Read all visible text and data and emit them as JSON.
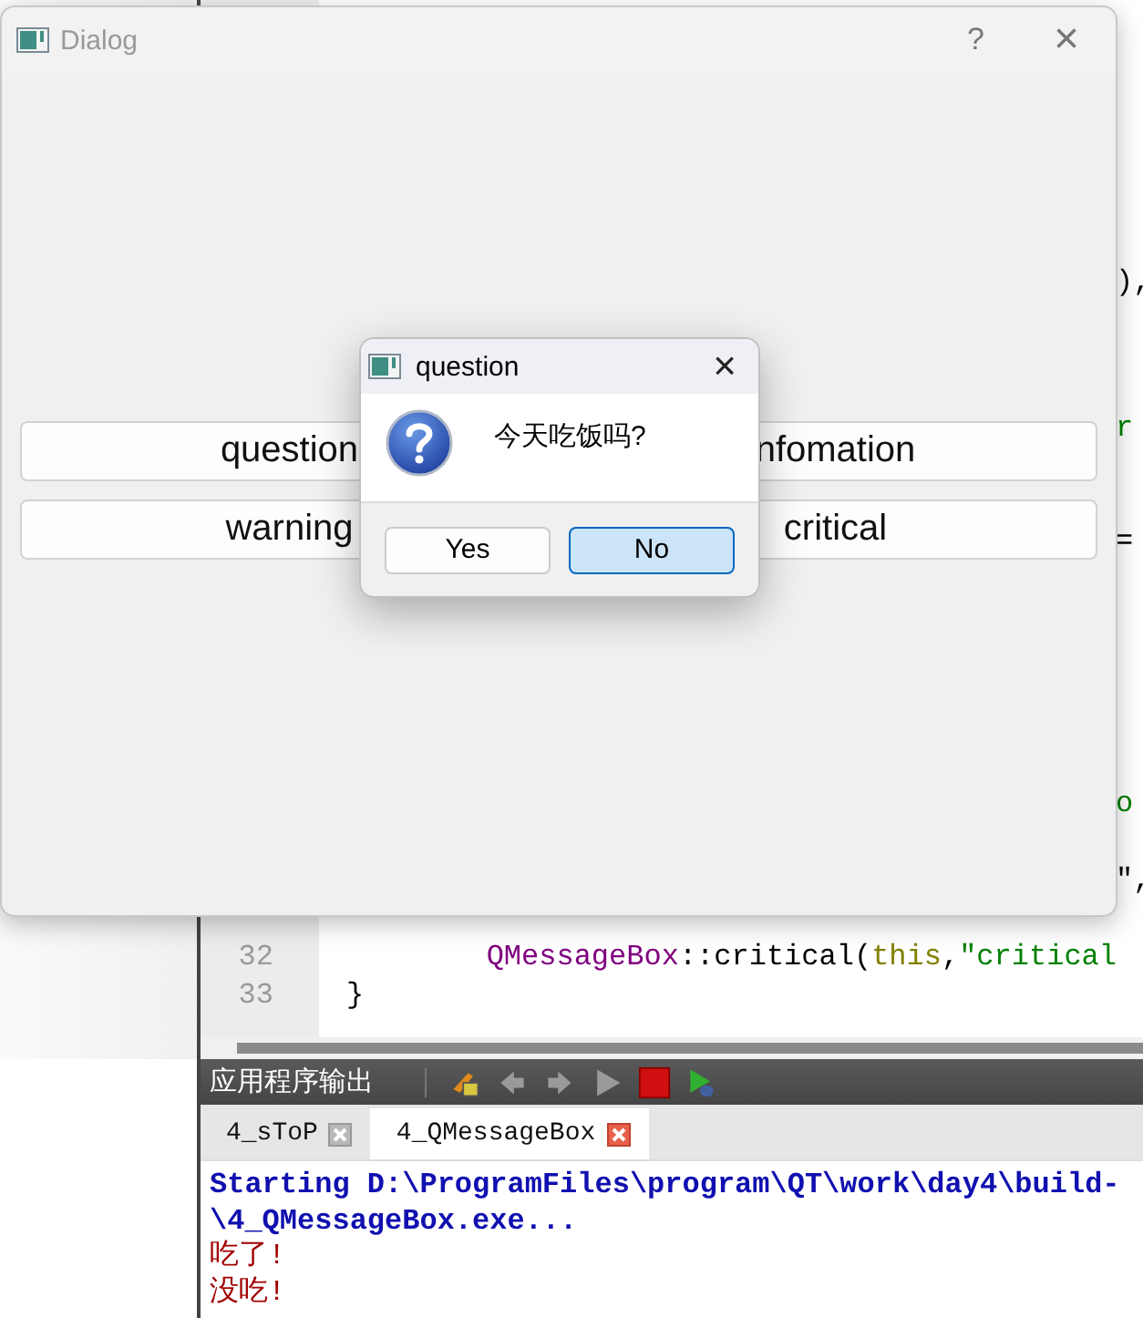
{
  "editor": {
    "right_fragments": [
      {
        "tokens": [
          {
            "kind": "plain",
            "text": "),"
          }
        ]
      },
      {
        "tokens": [
          {
            "kind": "string",
            "text": "r"
          }
        ]
      },
      {
        "tokens": [
          {
            "kind": "plain",
            "text": "="
          }
        ]
      },
      {
        "tokens": [
          {
            "kind": "string",
            "text": "o"
          }
        ]
      },
      {
        "tokens": [
          {
            "kind": "plain",
            "text": "\","
          }
        ]
      }
    ],
    "lines": [
      {
        "number": "32",
        "tokens": [
          {
            "kind": "type",
            "text": "        QMessageBox"
          },
          {
            "kind": "plain",
            "text": "::critical("
          },
          {
            "kind": "keyword",
            "text": "this"
          },
          {
            "kind": "plain",
            "text": ","
          },
          {
            "kind": "string",
            "text": "\"critical"
          }
        ]
      },
      {
        "number": "33",
        "tokens": [
          {
            "kind": "plain",
            "text": "}"
          }
        ]
      }
    ]
  },
  "output": {
    "title": "应用程序输出",
    "tools": [
      {
        "kind": "clear",
        "disabled": false
      },
      {
        "kind": "prev",
        "disabled": true
      },
      {
        "kind": "next",
        "disabled": true
      },
      {
        "kind": "run",
        "disabled": true
      },
      {
        "kind": "stop",
        "disabled": false
      },
      {
        "kind": "debug",
        "disabled": false
      }
    ],
    "tabs": [
      {
        "label": "4_sToP",
        "selected": false
      },
      {
        "label": "4_QMessageBox",
        "selected": true
      }
    ],
    "lines": [
      {
        "kind": "info",
        "text": "Starting D:\\ProgramFiles\\program\\QT\\work\\day4\\build-"
      },
      {
        "kind": "info",
        "text": "\\4_QMessageBox.exe..."
      },
      {
        "kind": "stdout",
        "text": "吃了!"
      },
      {
        "kind": "stdout",
        "text": "没吃!"
      }
    ]
  },
  "dialog": {
    "title": "Dialog",
    "help": "?",
    "close": "×",
    "active": false,
    "buttons": [
      {
        "label": "question"
      },
      {
        "label": "nfomation"
      },
      {
        "label": "warning"
      },
      {
        "label": "critical"
      }
    ]
  },
  "message_box": {
    "title": "question",
    "close": "×",
    "text": "今天吃饭吗?",
    "buttons": [
      {
        "label": "Yes",
        "default": false
      },
      {
        "label": "No",
        "default": true
      }
    ]
  }
}
